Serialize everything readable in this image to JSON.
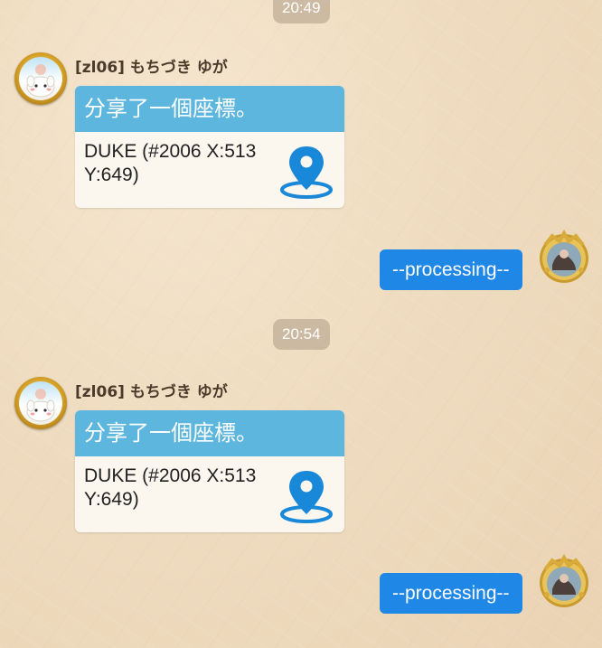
{
  "timestamps": [
    "20:49",
    "20:54"
  ],
  "messages": [
    {
      "sender": "[zl06] もちづき ゆが",
      "card_title": "分享了一個座標。",
      "card_body_line1": "DUKE (#2006 X:513",
      "card_body_line2": "Y:649)"
    },
    {
      "reply": "--processing--"
    },
    {
      "sender": "[zl06] もちづき ゆが",
      "card_title": "分享了一個座標。",
      "card_body_line1": "DUKE (#2006 X:513",
      "card_body_line2": "Y:649)"
    },
    {
      "reply": "--processing--"
    }
  ],
  "colors": {
    "card_header": "#5cb6dd",
    "reply_bubble": "#1f87e6",
    "pin": "#1a88d8",
    "background": "#efdcc0"
  },
  "icons": [
    "location-pin-icon",
    "avatar-left",
    "avatar-right"
  ]
}
